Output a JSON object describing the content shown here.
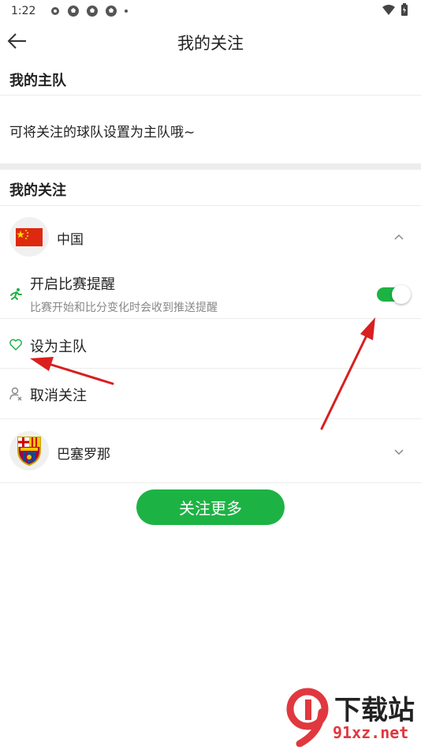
{
  "status_bar": {
    "time": "1:22"
  },
  "header": {
    "title": "我的关注"
  },
  "home_team_section": {
    "title": "我的主队",
    "hint": "可将关注的球队设置为主队哦~"
  },
  "follow_section": {
    "title": "我的关注",
    "teams": [
      {
        "name": "中国",
        "expanded": true,
        "options": {
          "reminder": {
            "label": "开启比赛提醒",
            "description": "比赛开始和比分变化时会收到推送提醒",
            "enabled": true
          },
          "set_home": {
            "label": "设为主队"
          },
          "unfollow": {
            "label": "取消关注"
          }
        }
      },
      {
        "name": "巴塞罗那",
        "expanded": false
      }
    ],
    "follow_more_label": "关注更多"
  },
  "watermark": {
    "top": "下载站",
    "bottom": "91xz.net"
  },
  "colors": {
    "accent": "#1db344",
    "arrow": "#d91f1f"
  }
}
